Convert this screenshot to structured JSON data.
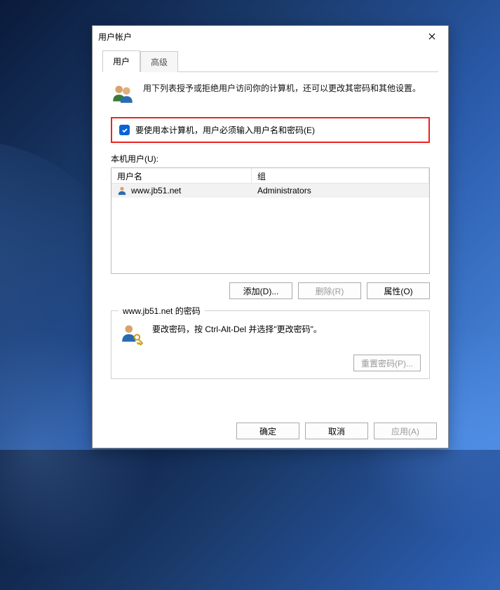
{
  "window": {
    "title": "用户帐户"
  },
  "tabs": {
    "user": "用户",
    "advanced": "高级"
  },
  "intro": "用下列表授予或拒绝用户访问你的计算机，还可以更改其密码和其他设置。",
  "checkbox": {
    "label": "要使用本计算机，用户必须输入用户名和密码(E)",
    "checked": true
  },
  "usersSection": {
    "label": "本机用户(U):",
    "columns": {
      "username": "用户名",
      "group": "组"
    },
    "rows": [
      {
        "username": "www.jb51.net",
        "group": "Administrators"
      }
    ]
  },
  "buttons": {
    "add": "添加(D)...",
    "remove": "删除(R)",
    "properties": "属性(O)",
    "resetPassword": "重置密码(P)...",
    "ok": "确定",
    "cancel": "取消",
    "apply": "应用(A)"
  },
  "passwordBox": {
    "titlePrefix": "www.jb51.net",
    "titleSuffix": " 的密码",
    "text": "要改密码，按 Ctrl-Alt-Del 并选择\"更改密码\"。"
  }
}
